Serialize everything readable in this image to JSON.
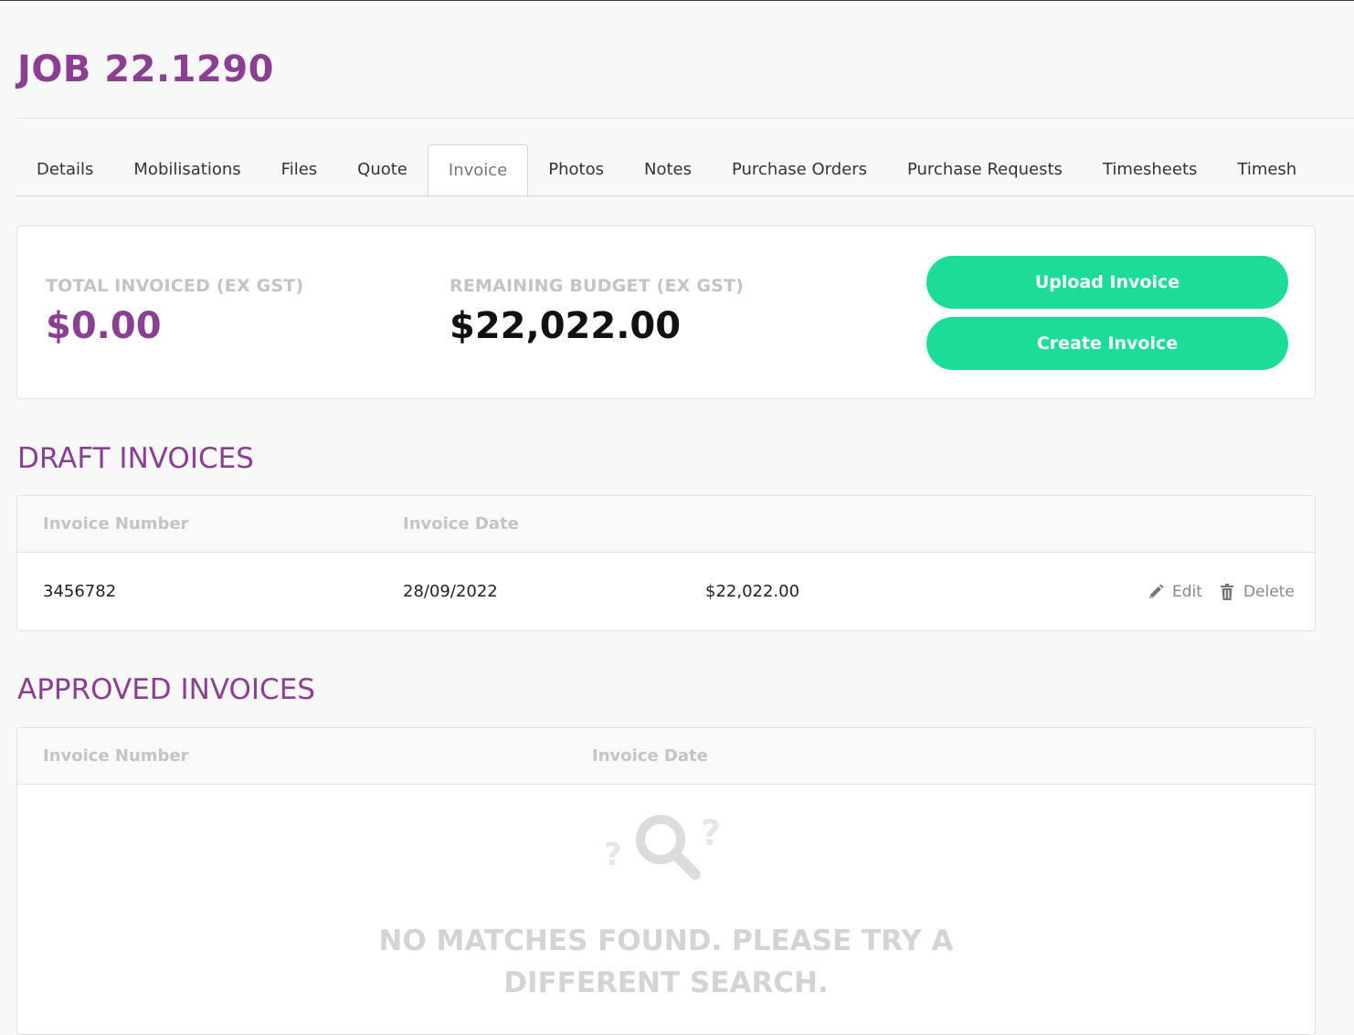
{
  "job": {
    "title": "JOB 22.1290"
  },
  "tabs": [
    {
      "label": "Details"
    },
    {
      "label": "Mobilisations"
    },
    {
      "label": "Files"
    },
    {
      "label": "Quote"
    },
    {
      "label": "Invoice",
      "active": true
    },
    {
      "label": "Photos"
    },
    {
      "label": "Notes"
    },
    {
      "label": "Purchase Orders"
    },
    {
      "label": "Purchase Requests"
    },
    {
      "label": "Timesheets"
    },
    {
      "label": "Timesh"
    }
  ],
  "summary": {
    "total_label": "TOTAL INVOICED (EX GST)",
    "total_value": "$0.00",
    "remaining_label": "REMAINING BUDGET (EX GST)",
    "remaining_value": "$22,022.00",
    "upload_button": "Upload Invoice",
    "create_button": "Create Invoice"
  },
  "draft": {
    "title": "DRAFT INVOICES",
    "col_number": "Invoice Number",
    "col_date": "Invoice Date",
    "rows": [
      {
        "number": "3456782",
        "date": "28/09/2022",
        "amount": "$22,022.00",
        "edit": "Edit",
        "delete": "Delete"
      }
    ]
  },
  "approved": {
    "title": "APPROVED INVOICES",
    "col_number": "Invoice Number",
    "col_date": "Invoice Date",
    "empty_line1": "NO MATCHES FOUND. PLEASE TRY A",
    "empty_line2": "DIFFERENT SEARCH."
  },
  "colors": {
    "brand_purple": "#8b3f93",
    "button_green": "#1ddc98",
    "muted_gray": "#c4c4c4"
  },
  "icons": [
    "pencil-icon",
    "trash-icon",
    "magnifier-question-icon"
  ]
}
